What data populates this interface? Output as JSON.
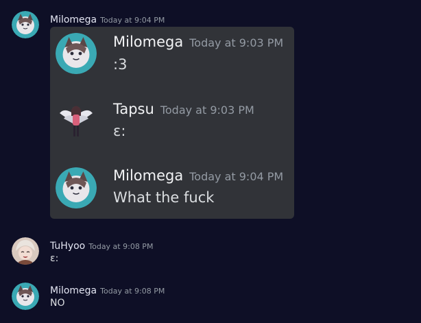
{
  "messages": [
    {
      "author": "Milomega",
      "timestamp": "Today at 9:04 PM",
      "content": ""
    },
    {
      "author": "TuHyoo",
      "timestamp": "Today at 9:08 PM",
      "content": "ɛ:"
    },
    {
      "author": "Milomega",
      "timestamp": "Today at 9:08 PM",
      "content": "NO"
    }
  ],
  "embed": {
    "messages": [
      {
        "author": "Milomega",
        "timestamp": "Today at 9:03 PM",
        "content": ":3"
      },
      {
        "author": "Tapsu",
        "timestamp": "Today at 9:03 PM",
        "content": "ɛ:"
      },
      {
        "author": "Milomega",
        "timestamp": "Today at 9:04 PM",
        "content": "What the fuck"
      }
    ]
  },
  "colors": {
    "background": "#0e0f26",
    "card": "#313338",
    "author": "#e3e5f2",
    "timestamp": "#949ba4",
    "text": "#dbdee1",
    "avatar_teal": "#3aa9b4"
  },
  "icons": [
    "milomega-avatar",
    "tapsu-avatar",
    "tuhyoo-avatar"
  ]
}
